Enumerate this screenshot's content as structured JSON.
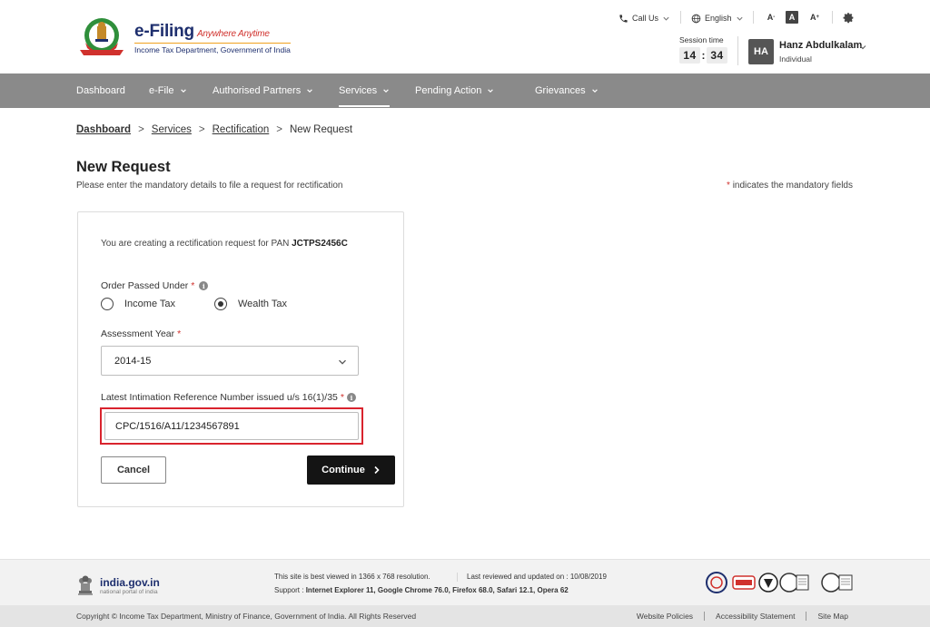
{
  "header": {
    "brand_title": "e-Filing",
    "brand_tagline": "Anywhere Anytime",
    "brand_sub": "Income Tax Department, Government of India",
    "call_us": "Call Us",
    "language": "English",
    "font_decrease": "A",
    "font_normal": "A",
    "font_increase": "A",
    "session_label": "Session time",
    "session_minutes": "14",
    "session_seconds": "34",
    "timer_separator": ":",
    "user_initials": "HA",
    "user_name": "Hanz Abdulkalam",
    "user_role": "Individual"
  },
  "nav": {
    "items": [
      {
        "label": "Dashboard"
      },
      {
        "label": "e-File"
      },
      {
        "label": "Authorised Partners"
      },
      {
        "label": "Services"
      },
      {
        "label": "Pending Action"
      },
      {
        "label": "Grievances"
      }
    ]
  },
  "breadcrumb": {
    "items": [
      "Dashboard",
      "Services",
      "Rectification",
      "New Request"
    ],
    "separator": ">"
  },
  "page": {
    "title": "New Request",
    "subtitle": "Please enter the mandatory details to file a request for rectification",
    "mandatory_star": "*",
    "mandatory_note": "indicates the mandatory fields"
  },
  "form": {
    "pan_intro": "You are creating a rectification request for PAN",
    "pan_value": "JCTPS2456C",
    "order_label": "Order Passed Under",
    "required_star": "*",
    "info_glyph": "i",
    "radio_options": [
      "Income Tax",
      "Wealth Tax"
    ],
    "radio_selected": "Wealth Tax",
    "assessment_label": "Assessment Year",
    "assessment_value": "2014-15",
    "reference_label": "Latest Intimation Reference Number issued u/s 16(1)/35",
    "reference_value": "CPC/1516/A11/1234567891",
    "cancel_label": "Cancel",
    "continue_label": "Continue"
  },
  "footer": {
    "gov_name": "india.gov.in",
    "gov_sub": "national portal of india",
    "best_viewed": "This site is best viewed in 1366 x 768 resolution.",
    "last_reviewed": "Last reviewed and updated on : 10/08/2019",
    "support_label": "Support :",
    "support_browsers": "Internet Explorer 11, Google Chrome 76.0,  Firefox 68.0, Safari 12.1, Opera 62",
    "copyright": "Copyright © Income Tax Department, Ministry of Finance, Government of India. All Rights Reserved",
    "links": [
      "Website Policies",
      "Accessibility Statement",
      "Site Map"
    ]
  },
  "colors": {
    "nav_bg": "#8a8a8a",
    "brand_blue": "#1e2f6e",
    "required_red": "#d0312d",
    "highlight_red": "#d9232d",
    "primary_button": "#141414"
  },
  "icons": {
    "call": "phone-icon",
    "language": "globe-icon",
    "settings": "gear-icon",
    "dropdown": "chevron-down-icon",
    "continue": "chevron-right-icon",
    "info": "info-icon"
  }
}
